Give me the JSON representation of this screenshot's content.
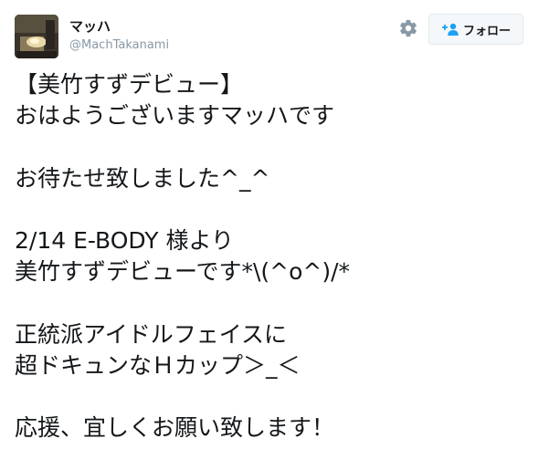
{
  "header": {
    "display_name": "マッハ",
    "screen_name": "@MachTakanami",
    "avatar_icon": "profile-photo-icon",
    "settings_icon": "gear-icon",
    "follow_icon": "add-person-icon",
    "follow_label": "フォロー"
  },
  "colors": {
    "text": "#14171a",
    "muted": "#8899a6",
    "accent": "#1da1f2",
    "button_bg": "#f5f8fa",
    "button_border": "#e1e8ed"
  },
  "tweet": {
    "lines": [
      "【美竹すずデビュー】",
      "おはようございますマッハです",
      "",
      "お待たせ致しました^_^",
      "",
      "2/14 E-BODY 様より",
      "美竹すずデビューです*\\(^o^)/*",
      "",
      "正統派アイドルフェイスに",
      "超ドキュンなＨカップ＞_＜",
      "",
      "応援、宜しくお願い致します！"
    ]
  }
}
